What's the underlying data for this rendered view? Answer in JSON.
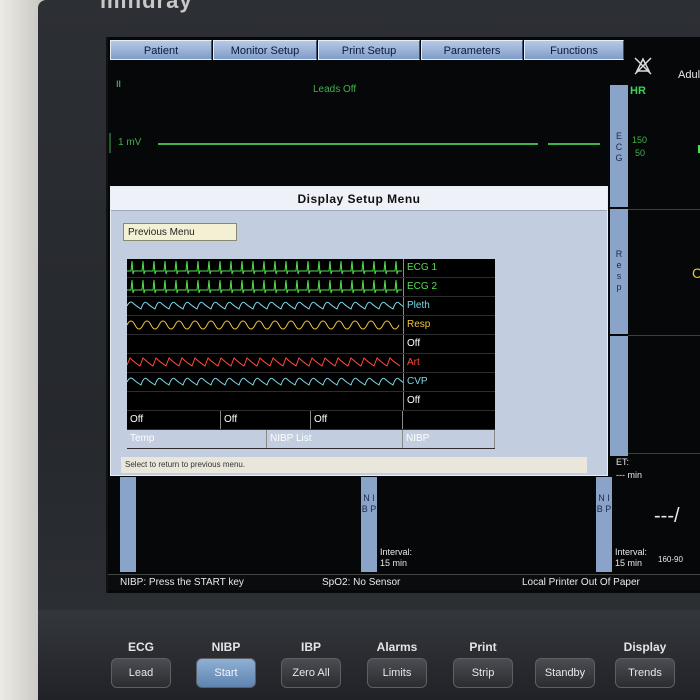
{
  "brand": "mindray",
  "menu": {
    "tabs": [
      "Patient",
      "Monitor Setup",
      "Print Setup",
      "Parameters",
      "Functions"
    ],
    "patient_type": "Adult"
  },
  "ecg": {
    "lead": "II",
    "leads_off": "Leads Off",
    "scale": "1 mV",
    "strip_letters": "E C G",
    "hr_label": "HR",
    "hr_alarm_high": "150",
    "hr_alarm_low": "50"
  },
  "resp": {
    "strip_letters": "R e s p",
    "channel_text": "C"
  },
  "popup": {
    "title": "Display Setup Menu",
    "previous_menu": "Previous Menu",
    "waveform_rows": [
      {
        "label": "ECG 1",
        "color": "#52e04a",
        "wave": "ecg"
      },
      {
        "label": "ECG 2",
        "color": "#52e04a",
        "wave": "ecg"
      },
      {
        "label": "Pleth",
        "color": "#7fd7e8",
        "wave": "pleth"
      },
      {
        "label": "Resp",
        "color": "#f0c43a",
        "wave": "resp"
      },
      {
        "label": "Off",
        "color": "#ffffff",
        "wave": "none"
      },
      {
        "label": "Art",
        "color": "#ff4a3a",
        "wave": "art"
      },
      {
        "label": "CVP",
        "color": "#7fd7e8",
        "wave": "cvp"
      },
      {
        "label": "Off",
        "color": "#ffffff",
        "wave": "none"
      }
    ],
    "param_row_a": [
      "Off",
      "Off",
      "Off"
    ],
    "param_row_b": [
      "Temp",
      "NIBP List",
      "NIBP"
    ],
    "hint": "Select to return to previous menu."
  },
  "nibp": {
    "strip_letters": "N I B P",
    "interval_label": "Interval:",
    "interval_value": "15 min",
    "et_label": "ET:",
    "et_value": "--- min",
    "reading": "---/",
    "range": "160-90"
  },
  "statusbar": {
    "nibp_msg": "NIBP: Press the START key",
    "spo2_msg": "SpO2: No Sensor",
    "printer_msg": "Local Printer Out Of Paper"
  },
  "hardware_keys": [
    {
      "caption": "ECG",
      "key": "Lead",
      "lit": false
    },
    {
      "caption": "NIBP",
      "key": "Start",
      "lit": true
    },
    {
      "caption": "IBP",
      "key": "Zero All",
      "lit": false
    },
    {
      "caption": "Alarms",
      "key": "Limits",
      "lit": false
    },
    {
      "caption": "Print",
      "key": "Strip",
      "lit": false
    },
    {
      "caption": "",
      "key": "Standby",
      "lit": false
    },
    {
      "caption": "Display",
      "key": "Trends",
      "lit": false
    }
  ]
}
